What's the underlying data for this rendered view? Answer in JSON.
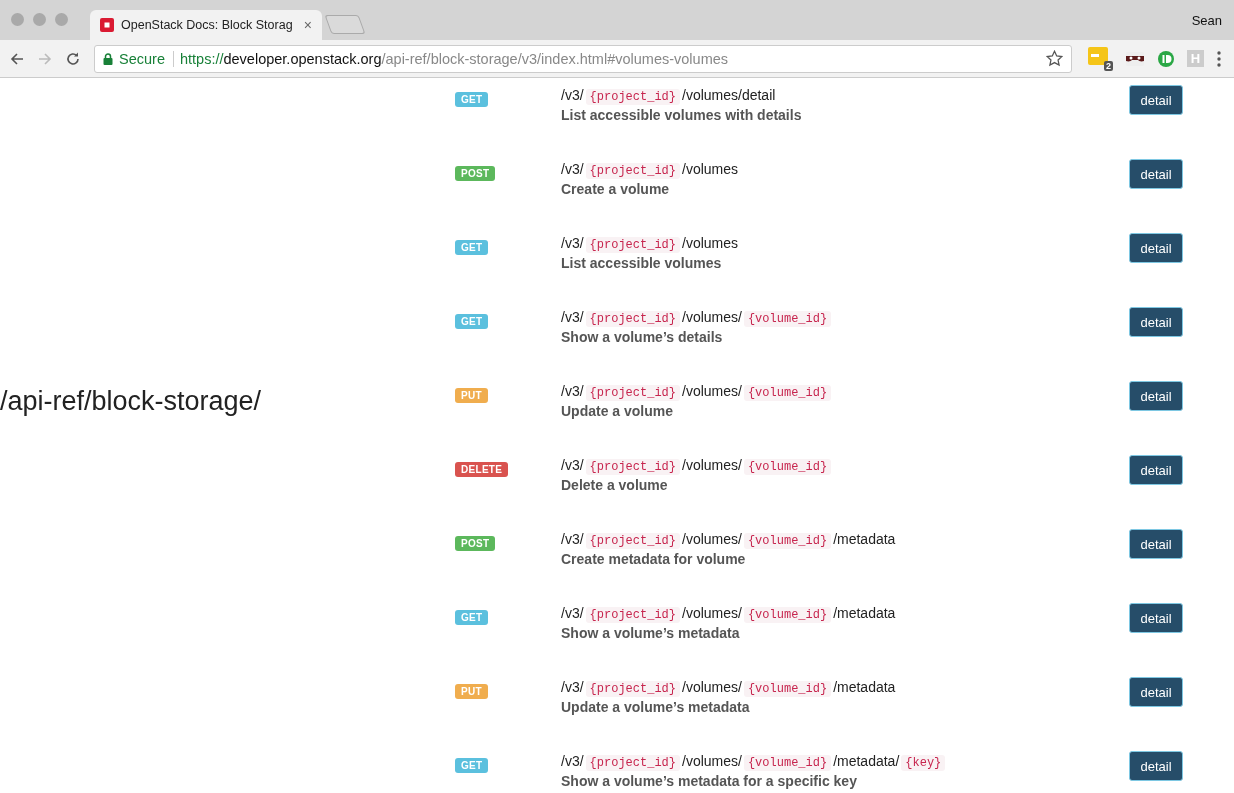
{
  "window": {
    "tab_title": "OpenStack Docs: Block Storag",
    "tab_close": "×",
    "profile": "Sean"
  },
  "toolbar": {
    "secure_label": "Secure",
    "url": {
      "scheme": "https://",
      "host": "developer.openstack.org",
      "path": "/api-ref/block-storage/v3/index.html#volumes-volumes"
    },
    "extension_badge": "2",
    "extension_letter": "H"
  },
  "side_heading": "/api-ref/block-storage/",
  "endpoints": [
    {
      "method": "GET",
      "path": [
        {
          "kind": "text",
          "text": "/v3/"
        },
        {
          "kind": "param",
          "text": "{project_id}"
        },
        {
          "kind": "text",
          "text": "/volumes/detail"
        }
      ],
      "summary": "List accessible volumes with details",
      "button": "detail"
    },
    {
      "method": "POST",
      "path": [
        {
          "kind": "text",
          "text": "/v3/"
        },
        {
          "kind": "param",
          "text": "{project_id}"
        },
        {
          "kind": "text",
          "text": "/volumes"
        }
      ],
      "summary": "Create a volume",
      "button": "detail"
    },
    {
      "method": "GET",
      "path": [
        {
          "kind": "text",
          "text": "/v3/"
        },
        {
          "kind": "param",
          "text": "{project_id}"
        },
        {
          "kind": "text",
          "text": "/volumes"
        }
      ],
      "summary": "List accessible volumes",
      "button": "detail"
    },
    {
      "method": "GET",
      "path": [
        {
          "kind": "text",
          "text": "/v3/"
        },
        {
          "kind": "param",
          "text": "{project_id}"
        },
        {
          "kind": "text",
          "text": "/volumes/"
        },
        {
          "kind": "param",
          "text": "{volume_id}"
        }
      ],
      "summary": "Show a volume’s details",
      "button": "detail"
    },
    {
      "method": "PUT",
      "path": [
        {
          "kind": "text",
          "text": "/v3/"
        },
        {
          "kind": "param",
          "text": "{project_id}"
        },
        {
          "kind": "text",
          "text": "/volumes/"
        },
        {
          "kind": "param",
          "text": "{volume_id}"
        }
      ],
      "summary": "Update a volume",
      "button": "detail"
    },
    {
      "method": "DELETE",
      "path": [
        {
          "kind": "text",
          "text": "/v3/"
        },
        {
          "kind": "param",
          "text": "{project_id}"
        },
        {
          "kind": "text",
          "text": "/volumes/"
        },
        {
          "kind": "param",
          "text": "{volume_id}"
        }
      ],
      "summary": "Delete a volume",
      "button": "detail"
    },
    {
      "method": "POST",
      "path": [
        {
          "kind": "text",
          "text": "/v3/"
        },
        {
          "kind": "param",
          "text": "{project_id}"
        },
        {
          "kind": "text",
          "text": "/volumes/"
        },
        {
          "kind": "param",
          "text": "{volume_id}"
        },
        {
          "kind": "text",
          "text": "/metadata"
        }
      ],
      "summary": "Create metadata for volume",
      "button": "detail"
    },
    {
      "method": "GET",
      "path": [
        {
          "kind": "text",
          "text": "/v3/"
        },
        {
          "kind": "param",
          "text": "{project_id}"
        },
        {
          "kind": "text",
          "text": "/volumes/"
        },
        {
          "kind": "param",
          "text": "{volume_id}"
        },
        {
          "kind": "text",
          "text": "/metadata"
        }
      ],
      "summary": "Show a volume’s metadata",
      "button": "detail"
    },
    {
      "method": "PUT",
      "path": [
        {
          "kind": "text",
          "text": "/v3/"
        },
        {
          "kind": "param",
          "text": "{project_id}"
        },
        {
          "kind": "text",
          "text": "/volumes/"
        },
        {
          "kind": "param",
          "text": "{volume_id}"
        },
        {
          "kind": "text",
          "text": "/metadata"
        }
      ],
      "summary": "Update a volume’s metadata",
      "button": "detail"
    },
    {
      "method": "GET",
      "path": [
        {
          "kind": "text",
          "text": "/v3/"
        },
        {
          "kind": "param",
          "text": "{project_id}"
        },
        {
          "kind": "text",
          "text": "/volumes/"
        },
        {
          "kind": "param",
          "text": "{volume_id}"
        },
        {
          "kind": "text",
          "text": "/metadata/"
        },
        {
          "kind": "param",
          "text": "{key}"
        }
      ],
      "summary": "Show a volume’s metadata for a specific key",
      "button": "detail"
    }
  ]
}
